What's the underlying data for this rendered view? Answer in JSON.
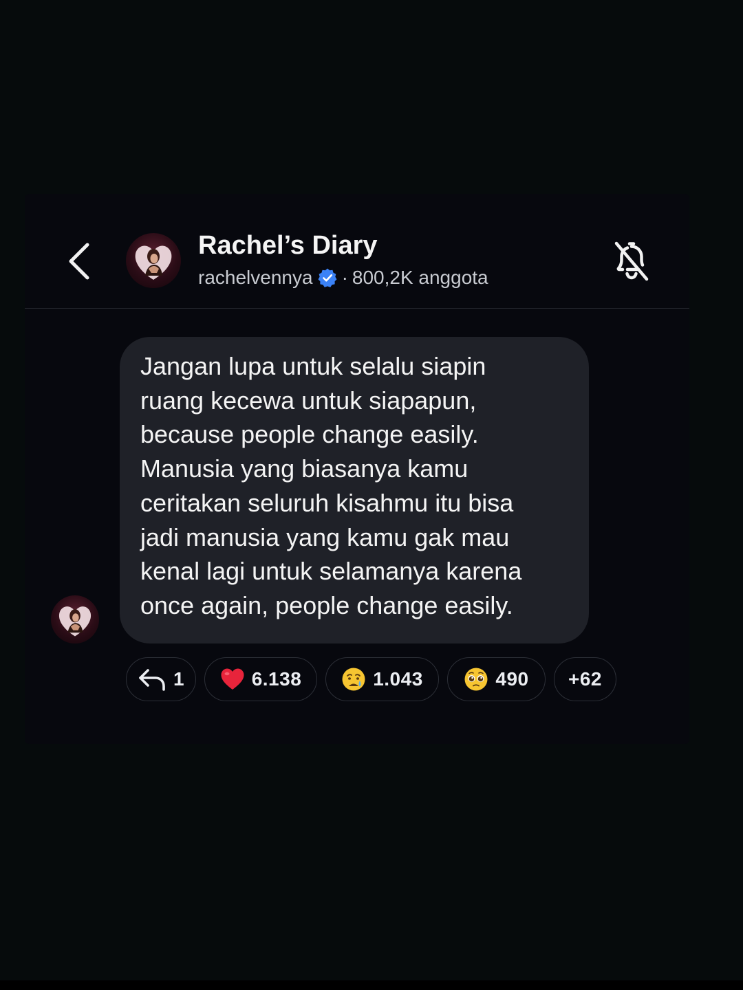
{
  "header": {
    "title": "Rachel’s Diary",
    "username": "rachelvennya",
    "separator": "·",
    "members": "800,2K anggota",
    "back_icon": "chevron-left-icon",
    "mute_icon": "bell-slash-icon",
    "verified_color": "#3b82f6"
  },
  "message": {
    "lines": [
      "Jangan lupa untuk selalu siapin",
      "ruang kecewa untuk siapapun,",
      "because people change easily.",
      "Manusia yang biasanya kamu",
      "ceritakan seluruh kisahmu itu bisa",
      "jadi manusia yang kamu gak mau",
      "kenal lagi untuk selamanya karena",
      "once again, people change easily."
    ]
  },
  "reactions": {
    "reply": {
      "icon": "reply-arrow-icon",
      "count": "1"
    },
    "heart": {
      "icon": "red-heart-emoji",
      "count": "6.138"
    },
    "crying": {
      "icon": "crying-face-emoji",
      "count": "1.043"
    },
    "pleading": {
      "icon": "pleading-face-emoji",
      "count": "490"
    },
    "more": {
      "label": "+62"
    }
  },
  "colors": {
    "background": "#060b0c",
    "card": "#07080e",
    "bubble": "#1f2128",
    "chip_border": "#2c2f37",
    "heart": "#e8243b",
    "emoji_yellow": "#f7c531"
  }
}
